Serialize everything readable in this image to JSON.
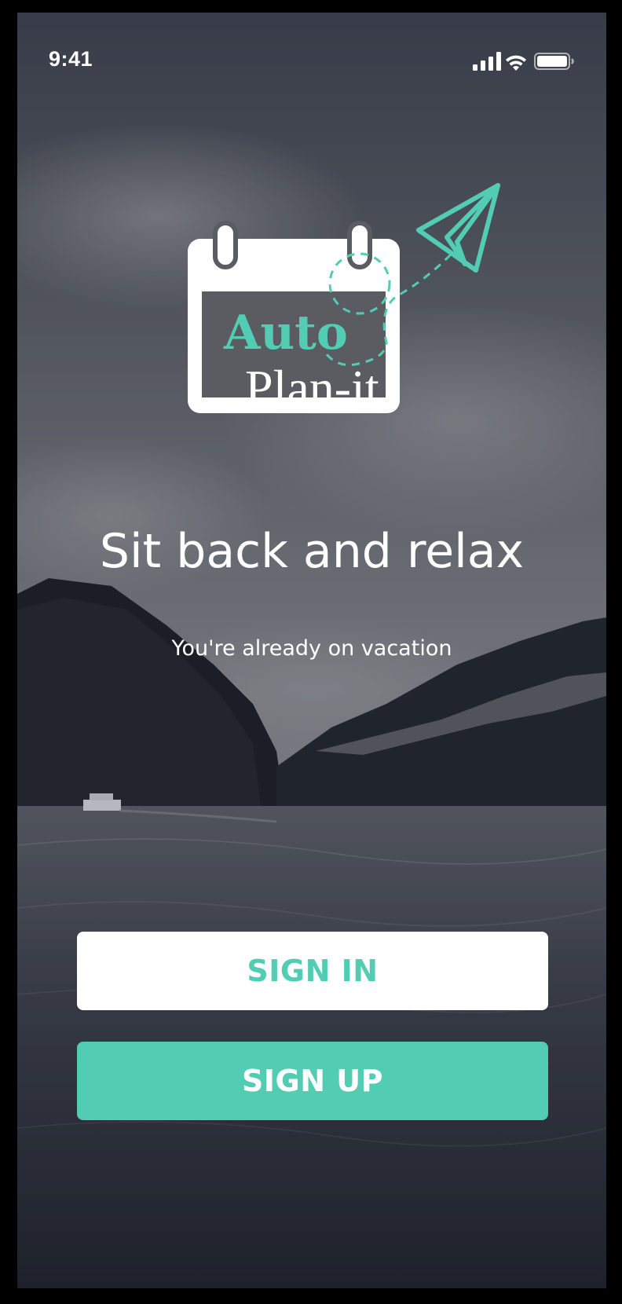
{
  "status_bar": {
    "time": "9:41",
    "icons": [
      "cellular-signal-icon",
      "wifi-icon",
      "battery-icon"
    ]
  },
  "logo": {
    "word1": "Auto",
    "word2": "Plan-it",
    "icons": [
      "calendar-icon",
      "paper-plane-icon"
    ]
  },
  "hero": {
    "headline": "Sit back and relax",
    "subline": "You're already on vacation"
  },
  "actions": {
    "sign_in_label": "SIGN IN",
    "sign_up_label": "SIGN UP"
  },
  "colors": {
    "accent": "#52cdb4",
    "text_on_dark": "#ffffff",
    "button_light_bg": "#ffffff"
  }
}
